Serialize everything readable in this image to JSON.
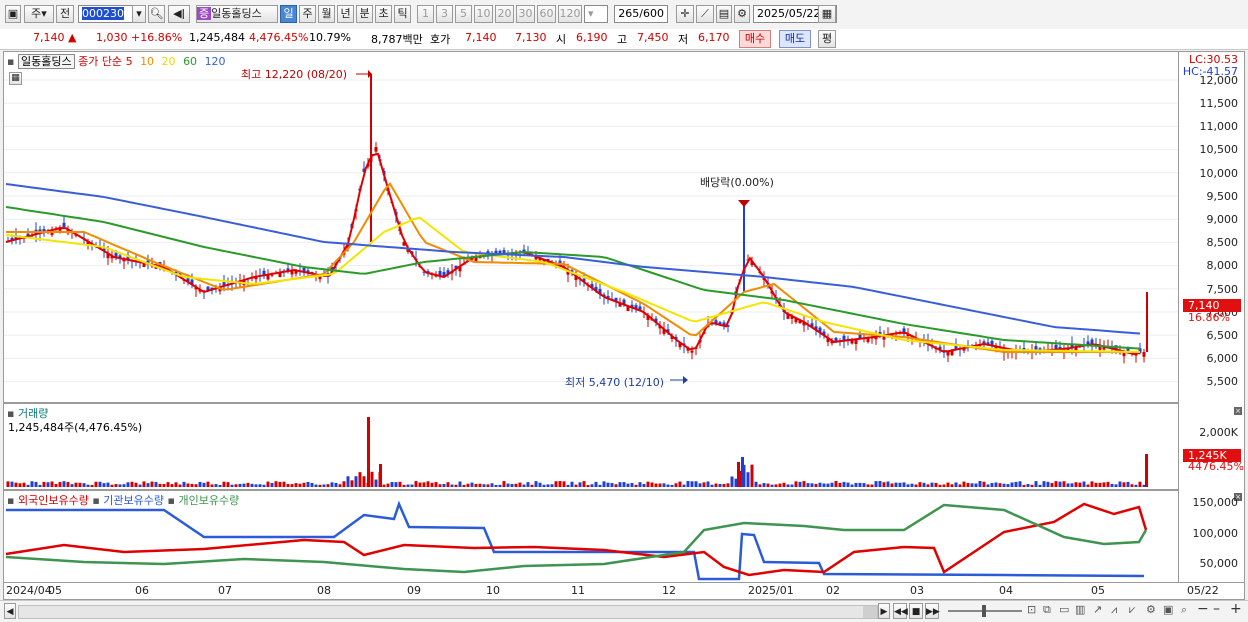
{
  "toolbar": {
    "market_label": "주",
    "prev_label": "전",
    "code_value": "000230",
    "stock_name": "일동홀딩스",
    "stock_badge": "증",
    "periods": [
      "일",
      "주",
      "월",
      "년",
      "분",
      "초",
      "틱"
    ],
    "active_period": "일",
    "intervals": [
      "1",
      "3",
      "5",
      "10",
      "20",
      "30",
      "60",
      "120"
    ],
    "count_value": "265",
    "count_total": "/600",
    "date_value": "2025/05/22"
  },
  "quote": {
    "price": "7,140",
    "change": "1,030",
    "change_pct": "+16.86%",
    "volume": "1,245,484",
    "volume_pct": "4,476.45%",
    "turnover": "10.79%",
    "amount": "8,787백만",
    "bid_label": "호가",
    "bid1": "7,140",
    "bid2": "7,130",
    "open_label": "시",
    "open": "6,190",
    "high_label": "고",
    "high": "7,450",
    "low_label": "저",
    "low": "6,170",
    "buy_label": "매수",
    "sell_label": "매도",
    "eval_label": "평"
  },
  "price_pane": {
    "name_tag": "일동홀딩스",
    "ma_prefix": "종가 단순",
    "ma_periods": [
      "5",
      "10",
      "20",
      "60",
      "120"
    ],
    "high_note": "최고 12,220 (08/20)",
    "low_note": "최저 5,470 (12/10)",
    "dividend_note": "배당락(0.00%)",
    "lc": "LC:30.53",
    "hc": "HC:-41.57",
    "y_ticks": [
      "12,000",
      "11,500",
      "11,000",
      "10,500",
      "10,000",
      "9,500",
      "9,000",
      "8,500",
      "8,000",
      "7,500",
      "7,000",
      "6,500",
      "6,000",
      "5,500"
    ],
    "last_price_tag": "7,140",
    "last_pct_tag": "16.86%"
  },
  "volume_pane": {
    "title": "거래량",
    "value_line": "1,245,484주(4,476.45%)",
    "y_tick": "2,000K",
    "last_tag": "1,245K",
    "last_pct": "4476.45%"
  },
  "holding_pane": {
    "series": [
      "외국인보유수량",
      "기관보유수량",
      "개인보유수량"
    ],
    "y_ticks": [
      "150,000",
      "100,000",
      "50,000"
    ]
  },
  "x_axis": {
    "labels": [
      "2024/04",
      "05",
      "06",
      "07",
      "08",
      "09",
      "10",
      "11",
      "12",
      "2025/01",
      "02",
      "03",
      "04",
      "05",
      "05/22"
    ]
  },
  "colors": {
    "up": "#d20000",
    "down": "#1f3fd0",
    "ma5": "#e00000",
    "ma10": "#f08c00",
    "ma20": "#f2e600",
    "ma60": "#2a9a2a",
    "ma120": "#3a5ed8",
    "foreign": "#e00000",
    "institution": "#2b5bd6",
    "individual": "#3e9450"
  }
}
